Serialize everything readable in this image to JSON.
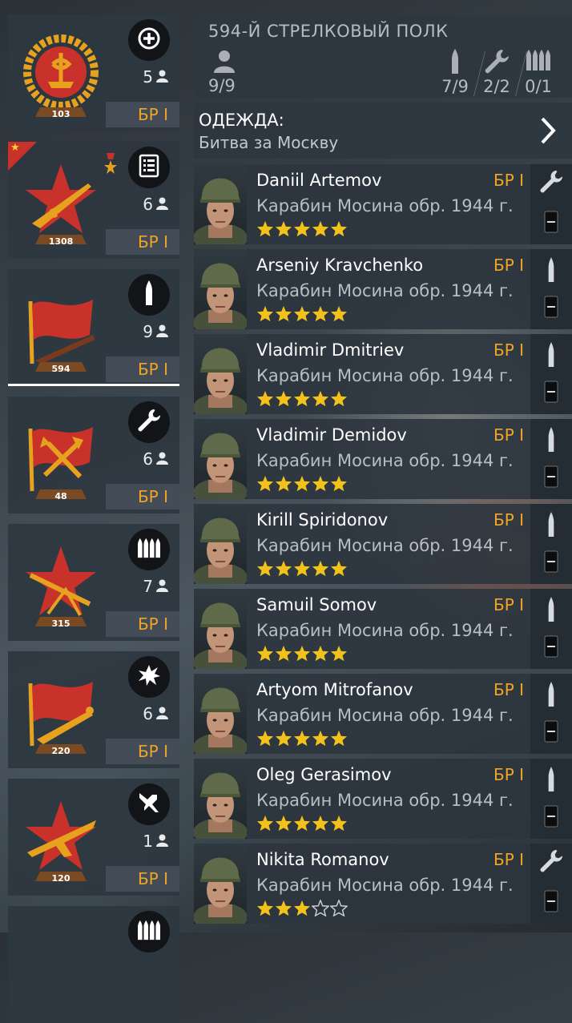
{
  "squads": [
    {
      "count": "5",
      "br": "БР I",
      "emblem_number": "103",
      "class_icon": "plus-icon",
      "emblem": "medic"
    },
    {
      "count": "6",
      "br": "БР I",
      "emblem_number": "1308",
      "class_icon": "list-icon",
      "emblem": "star-gun",
      "has_corner": true,
      "has_medal": true
    },
    {
      "count": "9",
      "br": "БР I",
      "emblem_number": "594",
      "class_icon": "bullet-icon",
      "emblem": "flag-rifle",
      "selected": true
    },
    {
      "count": "6",
      "br": "БР I",
      "emblem_number": "48",
      "class_icon": "wrench-icon",
      "emblem": "flag-axes"
    },
    {
      "count": "7",
      "br": "БР I",
      "emblem_number": "315",
      "class_icon": "ammo-icon",
      "emblem": "star-mg"
    },
    {
      "count": "6",
      "br": "БР I",
      "emblem_number": "220",
      "class_icon": "explosion-icon",
      "emblem": "flag-flamer"
    },
    {
      "count": "1",
      "br": "БР I",
      "emblem_number": "120",
      "class_icon": "plane-icon",
      "emblem": "star-plane"
    }
  ],
  "header": {
    "title": "594-Й СТРЕЛКОВЫЙ ПОЛК",
    "crew": "9/9",
    "slots": [
      {
        "icon": "bullet-icon",
        "value": "7/9"
      },
      {
        "icon": "wrench-icon",
        "value": "2/2"
      },
      {
        "icon": "ammo-icon",
        "value": "0/1"
      }
    ]
  },
  "outfit": {
    "label": "ОДЕЖДА:",
    "value": "Битва за Москву"
  },
  "soldiers": [
    {
      "name": "Daniil Artemov",
      "weapon": "Карабин Мосина обр. 1944 г.",
      "br": "БР I",
      "stars": 5,
      "role": "wrench-icon"
    },
    {
      "name": "Arseniy Kravchenko",
      "weapon": "Карабин Мосина обр. 1944 г.",
      "br": "БР I",
      "stars": 5,
      "role": "bullet-icon"
    },
    {
      "name": "Vladimir Dmitriev",
      "weapon": "Карабин Мосина обр. 1944 г.",
      "br": "БР I",
      "stars": 5,
      "role": "bullet-icon"
    },
    {
      "name": "Vladimir Demidov",
      "weapon": "Карабин Мосина обр. 1944 г.",
      "br": "БР I",
      "stars": 5,
      "role": "bullet-icon"
    },
    {
      "name": "Kirill Spiridonov",
      "weapon": "Карабин Мосина обр. 1944 г.",
      "br": "БР I",
      "stars": 5,
      "role": "bullet-icon"
    },
    {
      "name": "Samuil Somov",
      "weapon": "Карабин Мосина обр. 1944 г.",
      "br": "БР I",
      "stars": 5,
      "role": "bullet-icon"
    },
    {
      "name": "Artyom Mitrofanov",
      "weapon": "Карабин Мосина обр. 1944 г.",
      "br": "БР I",
      "stars": 5,
      "role": "bullet-icon"
    },
    {
      "name": "Oleg Gerasimov",
      "weapon": "Карабин Мосина обр. 1944 г.",
      "br": "БР I",
      "stars": 5,
      "role": "bullet-icon"
    },
    {
      "name": "Nikita Romanov",
      "weapon": "Карабин Мосина обр. 1944 г.",
      "br": "БР I",
      "stars": 3,
      "role": "wrench-icon"
    }
  ],
  "colors": {
    "accent": "#f0a524",
    "panel": "#2e3740",
    "emblem_red": "#c8322b",
    "emblem_gold": "#e6a21f",
    "star": "#f2c21b"
  }
}
